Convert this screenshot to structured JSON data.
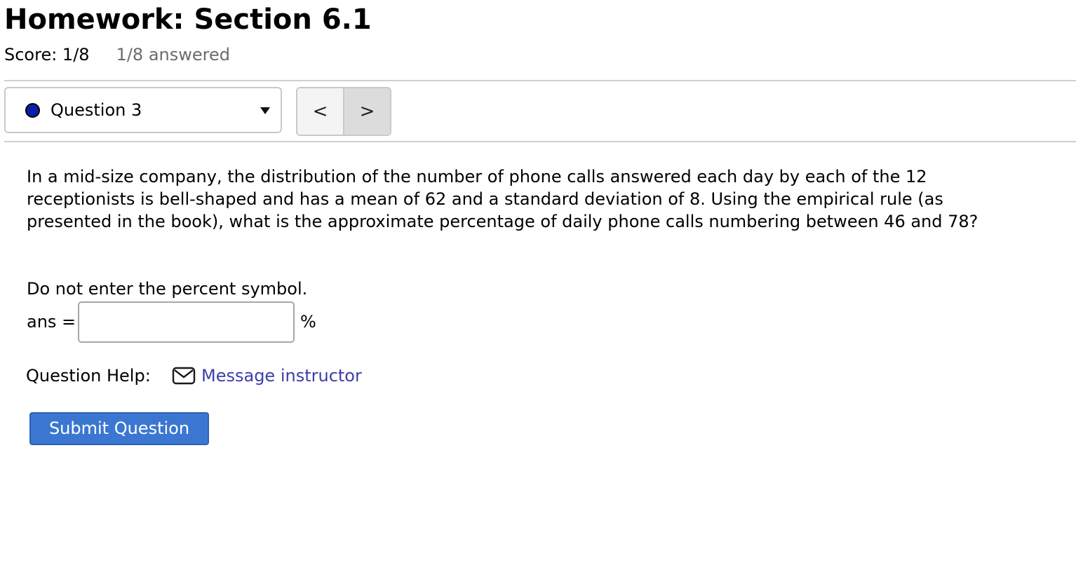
{
  "header": {
    "title": "Homework: Section 6.1",
    "score": "Score: 1/8",
    "answered": "1/8 answered"
  },
  "question_nav": {
    "current_label": "Question 3",
    "status_color": "#0a1fa8",
    "dropdown_icon": "caret-down-icon",
    "prev_label": "<",
    "next_label": ">"
  },
  "question": {
    "text": "In a mid-size company, the distribution of the number of phone calls answered each day by each of the 12 receptionists is bell-shaped and has a mean of 62 and a standard deviation of 8. Using the empirical rule (as presented in the book), what is the approximate percentage of daily phone calls numbering between 46 and 78?",
    "instruction": "Do not enter the percent symbol.",
    "answer_label": "ans =",
    "answer_value": "",
    "unit": "%"
  },
  "help": {
    "label": "Question Help:",
    "icon": "mail-icon",
    "link_text": "Message instructor"
  },
  "submit": {
    "label": "Submit Question"
  },
  "colors": {
    "accent": "#3b77d0",
    "link": "#3b3ea8",
    "muted": "#6b6b6b"
  }
}
